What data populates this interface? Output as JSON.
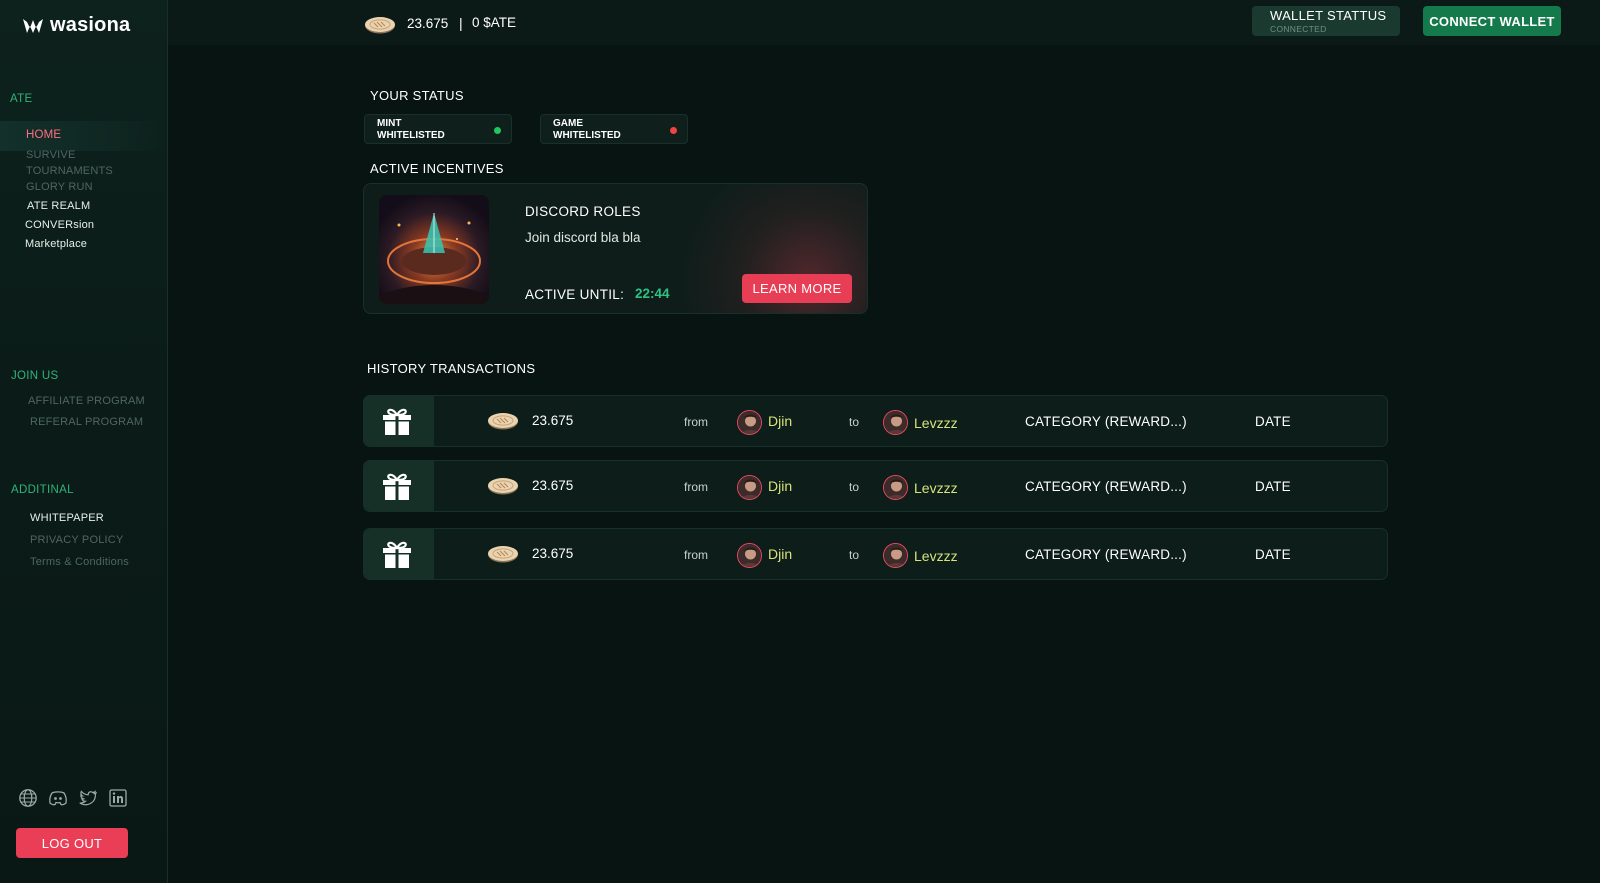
{
  "app": {
    "name": "wasiona"
  },
  "header": {
    "coin_balance": "23.675",
    "separator": "|",
    "ate_balance": "0 $ATE",
    "wallet_status": {
      "title": "WALLET STATTUS",
      "subtitle": "CONNECTED"
    },
    "connect_label": "CONNECT WALLET"
  },
  "sidebar": {
    "section_ate": "ATE",
    "nav": [
      {
        "label": "HOME",
        "state": "active"
      },
      {
        "label": "SURVIVE",
        "state": "dim"
      },
      {
        "label": "TOURNAMENTS",
        "state": "dim"
      },
      {
        "label": "GLORY RUN",
        "state": "dim"
      },
      {
        "label": "ATE REALM",
        "state": "bright"
      },
      {
        "label": "CONVERsion",
        "state": "bright"
      },
      {
        "label": "Marketplace",
        "state": "bright"
      }
    ],
    "section_join": "JOIN US",
    "join_items": [
      {
        "label": "AFFILIATE PROGRAM"
      },
      {
        "label": "REFERAL PROGRAM"
      }
    ],
    "section_additional": "ADDITINAL",
    "additional_items": [
      {
        "label": "WHITEPAPER"
      },
      {
        "label": "PRIVACY POLICY"
      },
      {
        "label": "Terms & Conditions"
      }
    ],
    "socials": [
      "globe-icon",
      "discord-icon",
      "twitter-icon",
      "linkedin-icon"
    ],
    "logout_label": "LOG OUT"
  },
  "status": {
    "title": "YOUR STATUS",
    "items": [
      {
        "line1": "MINT",
        "line2": "WHITELISTED",
        "dot_color": "#22c55e"
      },
      {
        "line1": "GAME",
        "line2": "WHITELISTED",
        "dot_color": "#ef4444"
      }
    ]
  },
  "incentives": {
    "title": "ACTIVE INCENTIVES",
    "card": {
      "title": "DISCORD ROLES",
      "description": "Join discord bla bla",
      "until_label": "ACTIVE UNTIL:",
      "until_value": "22:44",
      "button_label": "LEARN MORE"
    }
  },
  "history": {
    "title": "HISTORY TRANSACTIONS",
    "rows": [
      {
        "amount": "23.675",
        "from_label": "from",
        "from_user": "Djin",
        "to_label": "to",
        "to_user": "Levzzz",
        "category": "CATEGORY (REWARD...)",
        "date": "DATE"
      },
      {
        "amount": "23.675",
        "from_label": "from",
        "from_user": "Djin",
        "to_label": "to",
        "to_user": "Levzzz",
        "category": "CATEGORY (REWARD...)",
        "date": "DATE"
      },
      {
        "amount": "23.675",
        "from_label": "from",
        "from_user": "Djin",
        "to_label": "to",
        "to_user": "Levzzz",
        "category": "CATEGORY (REWARD...)",
        "date": "DATE"
      }
    ]
  },
  "colors": {
    "accent_red": "#ea3e57",
    "accent_green": "#157a4b",
    "username": "#d8e37a",
    "timer": "#2fc084"
  }
}
